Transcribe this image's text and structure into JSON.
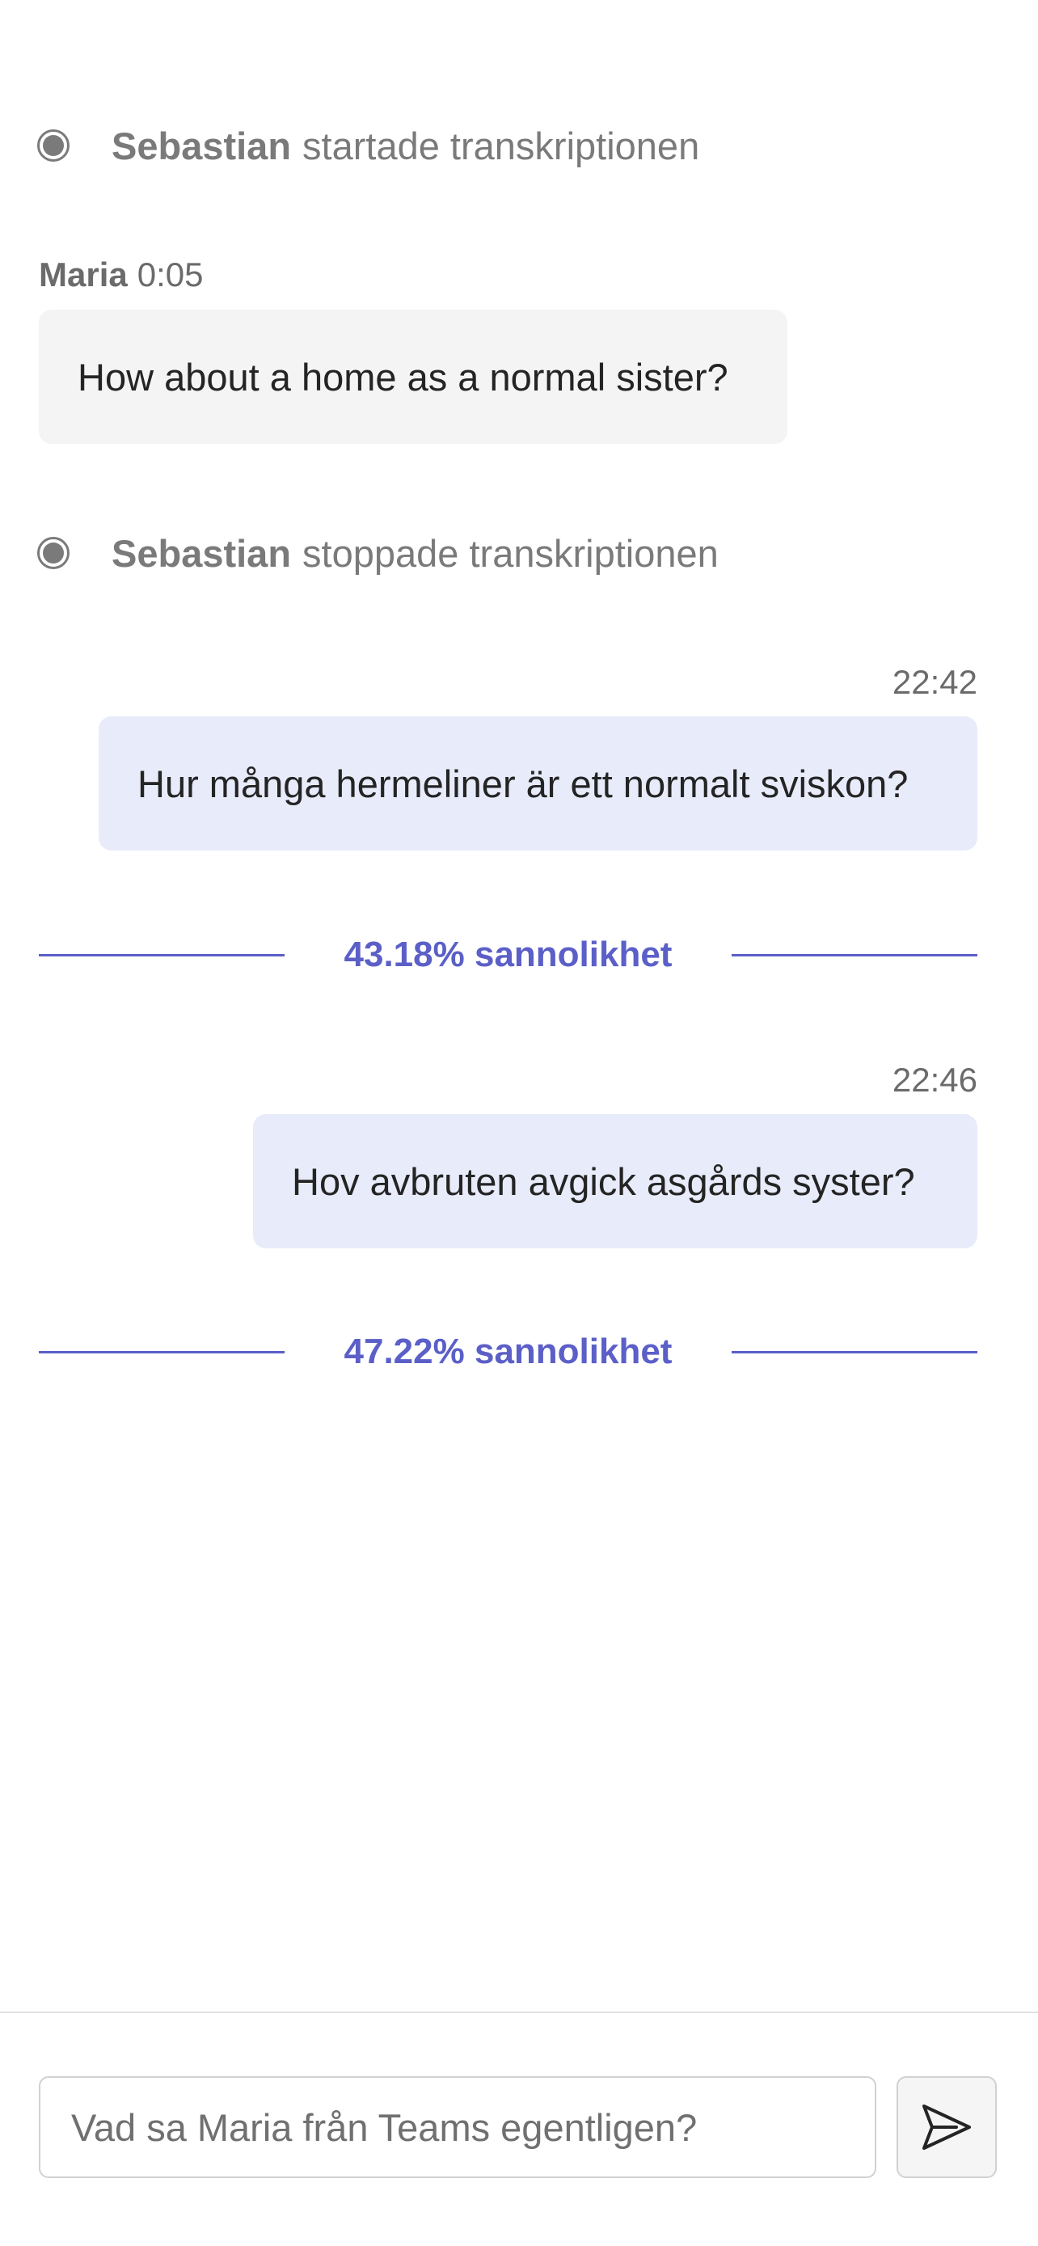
{
  "transcript": {
    "start_event": {
      "name": "Sebastian",
      "action": "startade transkriptionen"
    },
    "first_message": {
      "sender": "Maria",
      "time": "0:05",
      "text": "How about a home as a normal sister?"
    },
    "stop_event": {
      "name": "Sebastian",
      "action": "stoppade transkriptionen"
    }
  },
  "messages": [
    {
      "time": "22:42",
      "text": "Hur många hermeliner är ett normalt sviskon?",
      "probability": "43.18% sannolikhet"
    },
    {
      "time": "22:46",
      "text": "Hov avbruten avgick asgårds syster?",
      "probability": "47.22% sannolikhet"
    }
  ],
  "composer": {
    "placeholder": "Vad sa Maria från Teams egentligen?",
    "send_icon": "send-icon"
  },
  "colors": {
    "accent": "#5b5fc7",
    "outgoing_bubble": "#e8ebfa",
    "incoming_bubble": "#f4f4f4",
    "muted_text": "#7a7a7a"
  }
}
